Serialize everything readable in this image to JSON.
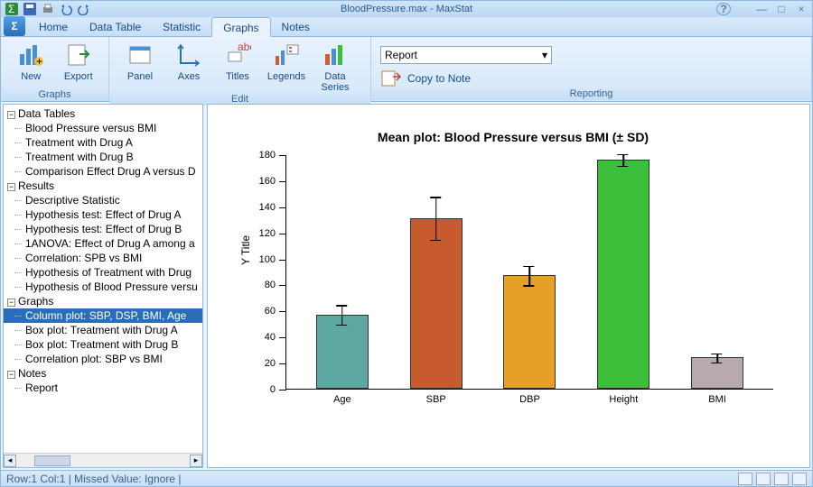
{
  "window_title": "BloodPressure.max - MaxStat",
  "menu_tabs": [
    "Home",
    "Data Table",
    "Statistic",
    "Graphs",
    "Notes"
  ],
  "active_tab": "Graphs",
  "ribbon": {
    "graphs_group": {
      "label": "Graphs",
      "new": "New",
      "export": "Export"
    },
    "edit_group": {
      "label": "Edit",
      "panel": "Panel",
      "axes": "Axes",
      "titles": "Titles",
      "legends": "Legends",
      "series": "Data\nSeries"
    },
    "reporting_group": {
      "label": "Reporting",
      "dropdown": "Report",
      "copy": "Copy to Note"
    }
  },
  "tree": {
    "data_tables": {
      "label": "Data Tables",
      "items": [
        "Blood Pressure versus BMI",
        "Treatment with Drug A",
        "Treatment with Drug B",
        "Comparison Effect Drug A versus D"
      ]
    },
    "results": {
      "label": "Results",
      "items": [
        "Descriptive Statistic",
        "Hypothesis test: Effect of Drug A",
        "Hypothesis test: Effect of Drug B",
        "1ANOVA: Effect of Drug A among a",
        "Correlation: SPB vs BMI",
        "Hypothesis of Treatment with Drug",
        "Hypothesis of Blood Pressure versu"
      ]
    },
    "graphs": {
      "label": "Graphs",
      "items": [
        "Column plot: SBP, DSP, BMI, Age",
        "Box plot: Treatment with Drug A",
        "Box plot: Treatment with Drug B",
        "Correlation plot: SBP vs BMI"
      ]
    },
    "notes": {
      "label": "Notes",
      "items": [
        "Report"
      ]
    },
    "selected": "Column plot: SBP, DSP, BMI, Age"
  },
  "chart_data": {
    "type": "bar",
    "title": "Mean plot: Blood Pressure versus BMI (± SD)",
    "ylabel": "Y Title",
    "ylim": [
      0,
      180
    ],
    "yticks": [
      0,
      20,
      40,
      60,
      80,
      100,
      120,
      140,
      160,
      180
    ],
    "categories": [
      "Age",
      "SBP",
      "DBP",
      "Height",
      "BMI"
    ],
    "values": [
      57,
      131,
      87,
      176,
      24
    ],
    "errors": [
      8,
      17,
      8,
      5,
      4
    ],
    "colors": [
      "#5da8a0",
      "#c75a2e",
      "#e6a028",
      "#3cc03c",
      "#b8a8b0"
    ]
  },
  "status": {
    "left": "Row:1 Col:1 | Missed Value: Ignore |"
  }
}
